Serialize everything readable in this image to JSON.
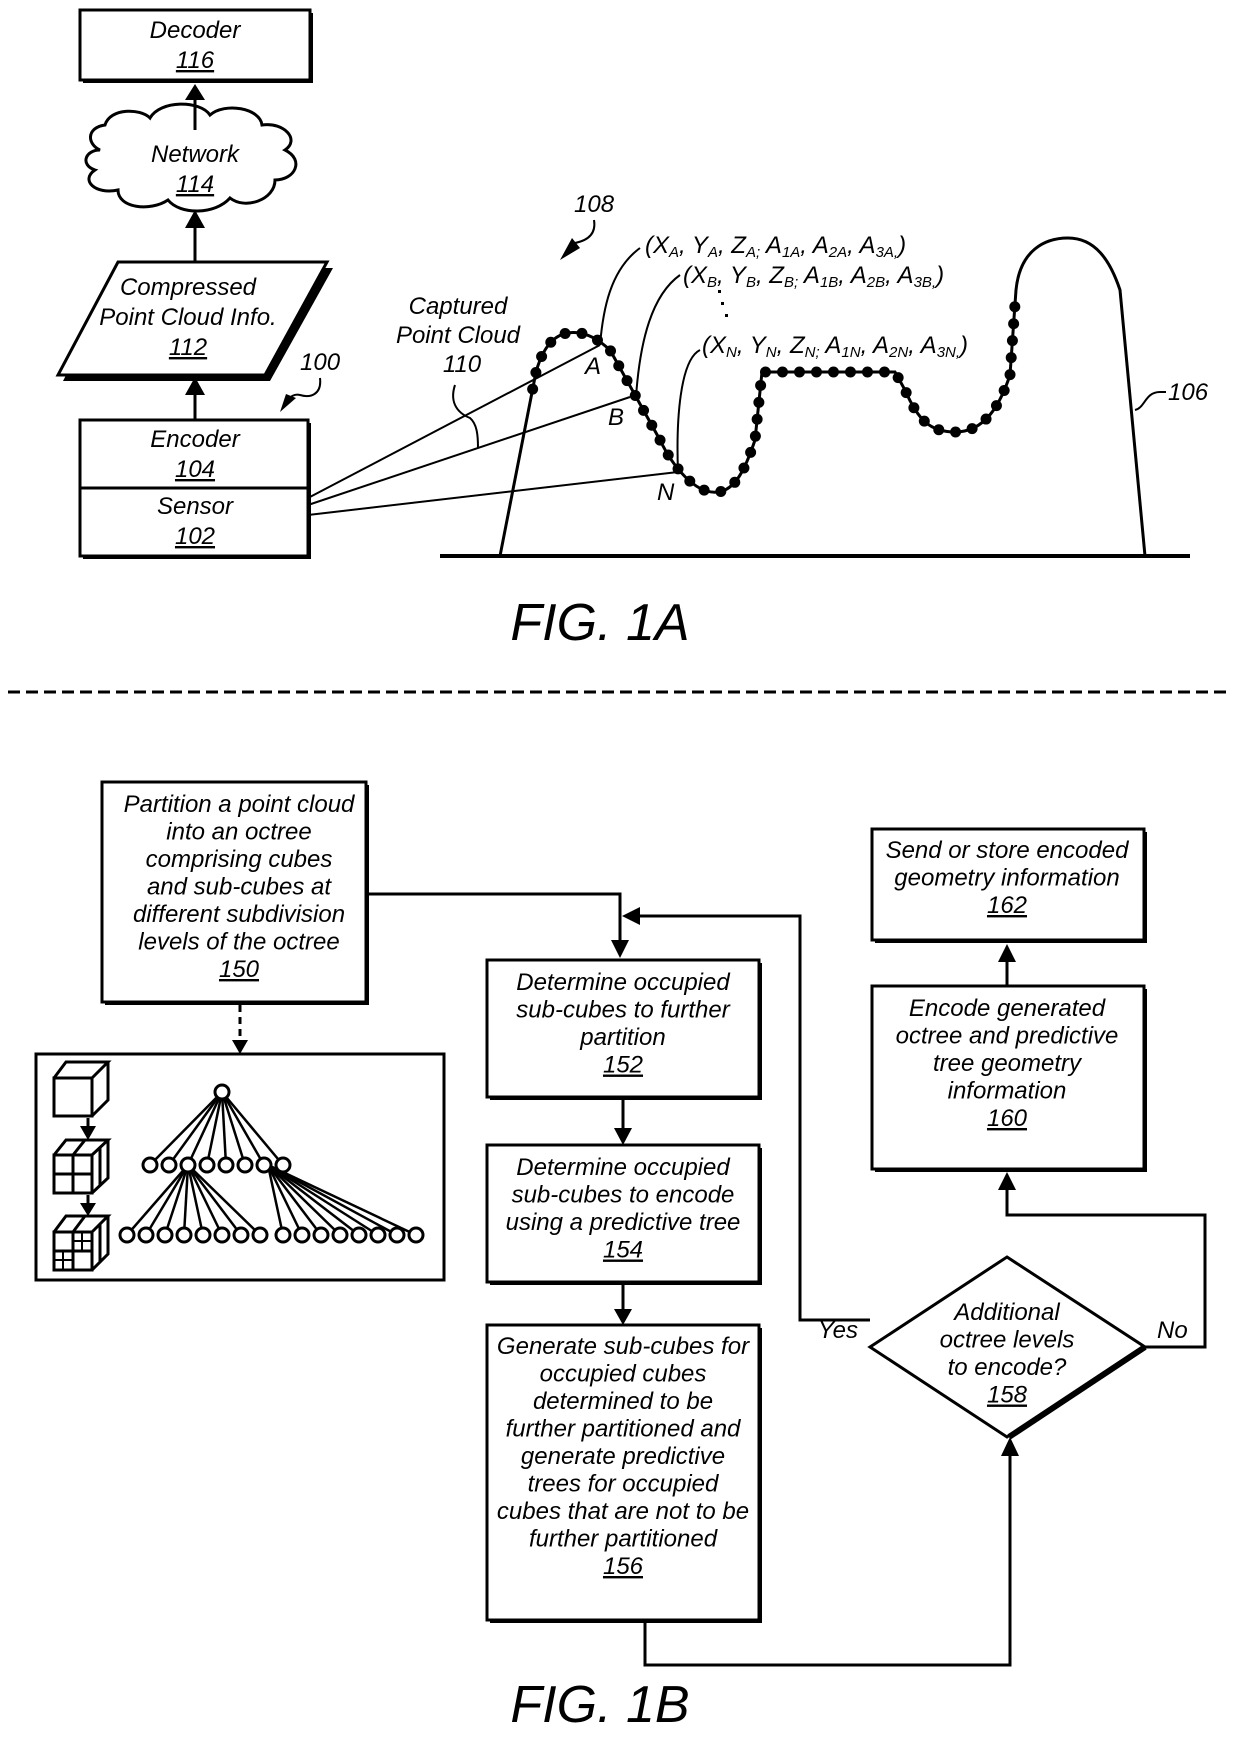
{
  "fig1a": {
    "caption": "FIG. 1A",
    "decoder": {
      "label": "Decoder",
      "ref": "116"
    },
    "network": {
      "label": "Network",
      "ref": "114"
    },
    "compressed": {
      "line1": "Compressed",
      "line2": "Point Cloud Info.",
      "ref": "112"
    },
    "encoder": {
      "label": "Encoder",
      "ref": "104"
    },
    "sensor": {
      "label": "Sensor",
      "ref": "102"
    },
    "system_ref": "100",
    "point_cloud_ref": "108",
    "captured": {
      "line1": "Captured",
      "line2": "Point Cloud",
      "ref": "110"
    },
    "object_ref": "106",
    "points": {
      "A": {
        "label": "A",
        "tuple": "(XA, YA, ZA; A1A, A2A, A3A,)"
      },
      "B": {
        "label": "B",
        "tuple": "(XB, YB, ZB; A1B, A2B, A3B,)"
      },
      "N": {
        "label": "N",
        "tuple": "(XN, YN, ZN; A1N, A2N, A3N,)"
      }
    },
    "ellipsis": "."
  },
  "fig1b": {
    "caption": "FIG. 1B",
    "step150": {
      "lines": [
        "Partition a point cloud",
        "into an octree",
        "comprising cubes",
        "and sub-cubes at",
        "different subdivision",
        "levels of the octree"
      ],
      "ref": "150"
    },
    "step152": {
      "lines": [
        "Determine occupied",
        "sub-cubes to further",
        "partition"
      ],
      "ref": "152"
    },
    "step154": {
      "lines": [
        "Determine occupied",
        "sub-cubes to encode",
        "using a predictive tree"
      ],
      "ref": "154"
    },
    "step156": {
      "lines": [
        "Generate sub-cubes for",
        "occupied cubes",
        "determined to be",
        "further partitioned and",
        "generate predictive",
        "trees for occupied",
        "cubes that are not to be",
        "further partitioned"
      ],
      "ref": "156"
    },
    "step158": {
      "lines": [
        "Additional",
        "octree levels",
        "to encode?"
      ],
      "ref": "158"
    },
    "step160": {
      "lines": [
        "Encode generated",
        "octree and predictive",
        "tree geometry",
        "information"
      ],
      "ref": "160"
    },
    "step162": {
      "lines": [
        "Send or store encoded",
        "geometry information"
      ],
      "ref": "162"
    },
    "yes_label": "Yes",
    "no_label": "No"
  }
}
